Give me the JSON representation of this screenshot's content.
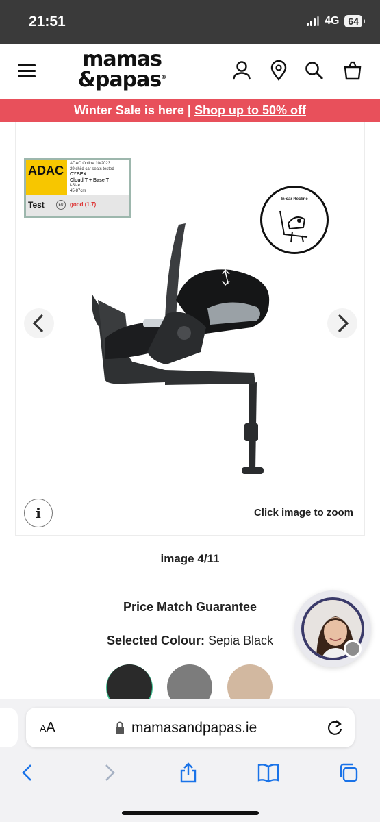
{
  "status_bar": {
    "time": "21:51",
    "network": "4G",
    "battery": "64"
  },
  "header": {
    "logo_line1": "mamas",
    "logo_line2": "&papas",
    "logo_mark": "®",
    "icons": [
      "menu-icon",
      "account-icon",
      "store-locator-icon",
      "search-icon",
      "basket-icon"
    ]
  },
  "promo": {
    "text": "Winter Sale is here | ",
    "link": "Shop up to 50% off",
    "color": "#e8505b"
  },
  "gallery": {
    "badge": {
      "brand": "ADAC",
      "line1": "ADAC Online 10/2023",
      "line2": "29 child car seats tested",
      "product1": "CYBEX",
      "product2": "Cloud T + Base T",
      "line3": "i-Size",
      "line4": "45-87cm",
      "test": "Test",
      "eu": "EU",
      "rating": "good (1.7)"
    },
    "recline_label": "In-car Recline",
    "info_label": "i",
    "zoom_hint": "Click image to zoom"
  },
  "image_counter": "image 4/11",
  "price_match": "Price Match Guarantee",
  "selected_colour": {
    "label": "Selected Colour:",
    "value": " Sepia Black"
  },
  "swatches": [
    {
      "name": "Sepia Black",
      "color": "#2a2a2a"
    },
    {
      "name": "grey",
      "color": "#7c7c7c"
    },
    {
      "name": "beige",
      "color": "#d2b8a0"
    }
  ],
  "browser": {
    "aa": "AA",
    "url": "mamasandpapas.ie"
  }
}
